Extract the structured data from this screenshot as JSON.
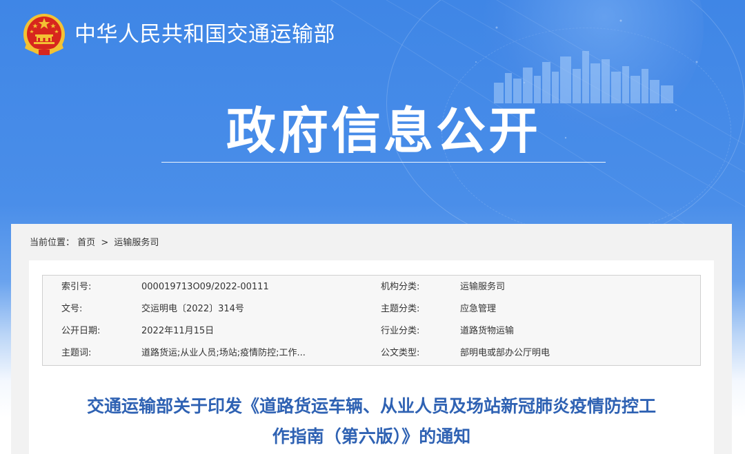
{
  "header": {
    "ministry_name": "中华人民共和国交通运输部",
    "section_title": "政府信息公开"
  },
  "breadcrumb": {
    "prefix": "当前位置：",
    "home": "首页",
    "separator": ">",
    "current": "运输服务司"
  },
  "metadata": {
    "rows": [
      {
        "k1": "索引号:",
        "v1": "000019713O09/2022-00111",
        "k2": "机构分类:",
        "v2": "运输服务司"
      },
      {
        "k1": "文号:",
        "v1": "交运明电〔2022〕314号",
        "k2": "主题分类:",
        "v2": "应急管理"
      },
      {
        "k1": "公开日期:",
        "v1": "2022年11月15日",
        "k2": "行业分类:",
        "v2": "道路货物运输"
      },
      {
        "k1": "主题词:",
        "v1": "道路货运;从业人员;场站;疫情防控;工作...",
        "k2": "公文类型:",
        "v2": "部明电或部办公厅明电"
      }
    ]
  },
  "document": {
    "title_line1": "交通运输部关于印发《道路货运车辆、从业人员及场站新冠肺炎疫情防控工",
    "title_line2": "作指南（第六版）》的通知"
  },
  "colors": {
    "banner_blue": "#3f86e6",
    "title_blue": "#2f62b3",
    "emblem_red": "#d7261e",
    "emblem_gold": "#f3c233"
  }
}
